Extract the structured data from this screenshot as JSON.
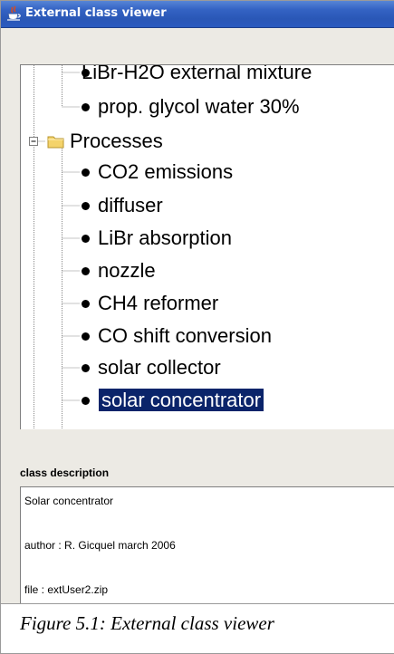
{
  "window": {
    "title": "External class viewer",
    "icon": "java-cup-icon"
  },
  "tree": {
    "items": [
      {
        "label": "LiBr-H2O external mixture",
        "type": "leaf",
        "icon": "bullet-icon"
      },
      {
        "label": "prop. glycol water 30%",
        "type": "leaf",
        "icon": "bullet-icon"
      },
      {
        "label": "Processes",
        "type": "folder",
        "expanded": true,
        "icon": "folder-icon"
      },
      {
        "label": "CO2 emissions",
        "type": "leaf",
        "icon": "bullet-icon"
      },
      {
        "label": "diffuser",
        "type": "leaf",
        "icon": "bullet-icon"
      },
      {
        "label": "LiBr absorption",
        "type": "leaf",
        "icon": "bullet-icon"
      },
      {
        "label": "nozzle",
        "type": "leaf",
        "icon": "bullet-icon"
      },
      {
        "label": "CH4 reformer",
        "type": "leaf",
        "icon": "bullet-icon"
      },
      {
        "label": "CO shift conversion",
        "type": "leaf",
        "icon": "bullet-icon"
      },
      {
        "label": "solar collector",
        "type": "leaf",
        "icon": "bullet-icon"
      },
      {
        "label": "solar concentrator",
        "type": "leaf",
        "selected": true,
        "icon": "bullet-icon"
      }
    ],
    "selection_color": "#0a246a"
  },
  "description": {
    "label": "class description",
    "lines": [
      "Solar concentrator",
      "author : R. Gicquel   march 2006",
      "file : extUser2.zip"
    ]
  },
  "caption": "Figure 5.1: External class viewer",
  "colors": {
    "titlebar": "#2a57b6",
    "panel": "#eceae4",
    "selection": "#0a246a"
  }
}
